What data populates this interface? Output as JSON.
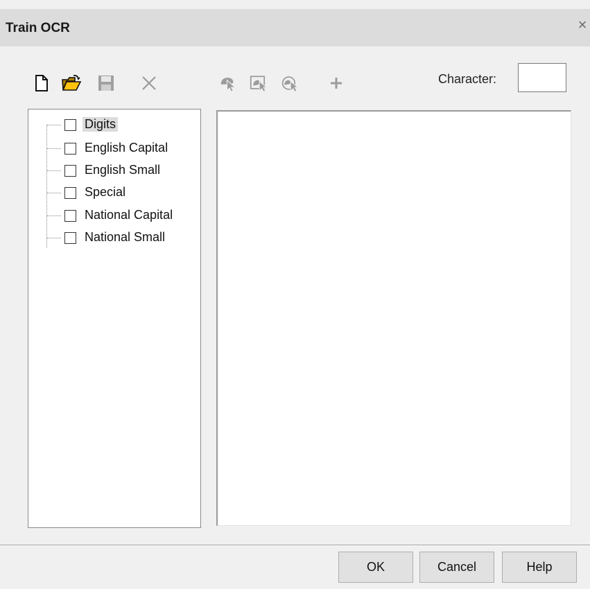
{
  "window": {
    "title": "Train OCR",
    "close_glyph": "×"
  },
  "toolbar": {
    "icons": [
      "new-document-icon",
      "open-folder-icon",
      "save-icon",
      "delete-icon",
      "select-region-icon",
      "select-image-icon",
      "select-all-icon",
      "add-icon"
    ],
    "character_label": "Character:",
    "character_value": ""
  },
  "tree": {
    "items": [
      {
        "label": "Digits",
        "checked": false,
        "selected": true
      },
      {
        "label": "English Capital",
        "checked": false,
        "selected": false
      },
      {
        "label": "English Small",
        "checked": false,
        "selected": false
      },
      {
        "label": "Special",
        "checked": false,
        "selected": false
      },
      {
        "label": "National Capital",
        "checked": false,
        "selected": false
      },
      {
        "label": "National Small",
        "checked": false,
        "selected": false
      }
    ]
  },
  "buttons": {
    "ok": "OK",
    "cancel": "Cancel",
    "help": "Help"
  },
  "colors": {
    "dialog_bg": "#f0f0f0",
    "titlebar_bg": "#dcdcdc",
    "open_icon": "#e0a800",
    "disabled_icon": "#9c9c9c"
  }
}
